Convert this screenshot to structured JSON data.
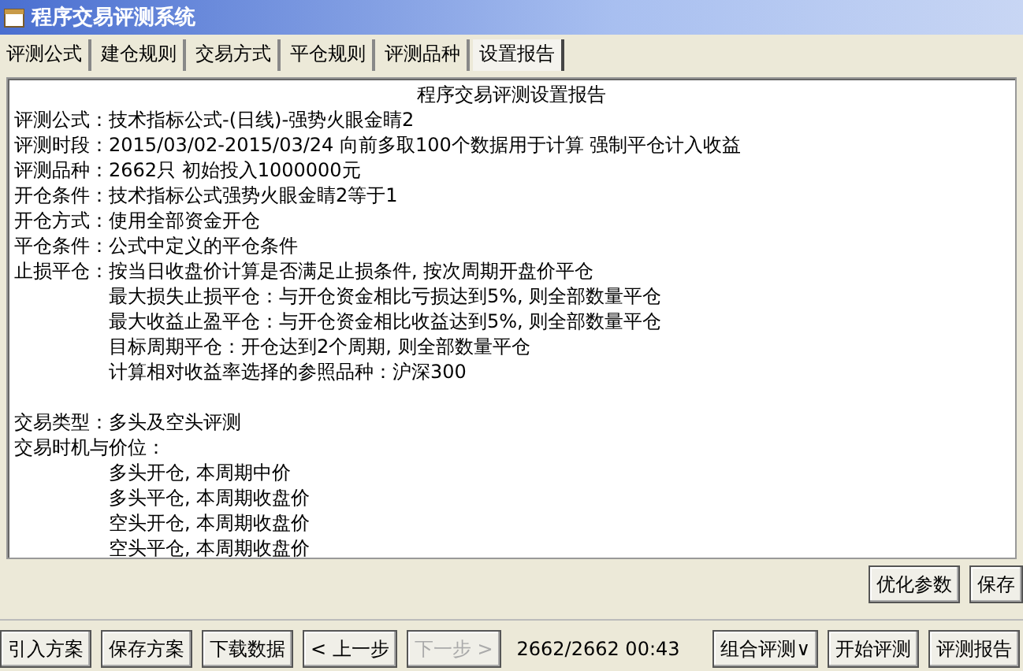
{
  "window": {
    "title": "程序交易评测系统"
  },
  "tabs": [
    {
      "label": "评测公式",
      "selected": false
    },
    {
      "label": "建仓规则",
      "selected": false
    },
    {
      "label": "交易方式",
      "selected": false
    },
    {
      "label": "平仓规则",
      "selected": false
    },
    {
      "label": "评测品种",
      "selected": false
    },
    {
      "label": "设置报告",
      "selected": true
    }
  ],
  "report": {
    "title": "程序交易评测设置报告",
    "lines": [
      {
        "kind": "field",
        "label": "评测公式：",
        "value": "技术指标公式-(日线)-强势火眼金睛2"
      },
      {
        "kind": "field",
        "label": "评测时段：",
        "value": "2015/03/02-2015/03/24  向前多取100个数据用于计算  强制平仓计入收益"
      },
      {
        "kind": "field",
        "label": "评测品种：",
        "value": "2662只  初始投入1000000元"
      },
      {
        "kind": "field",
        "label": "开仓条件：",
        "value": "技术指标公式强势火眼金睛2等于1"
      },
      {
        "kind": "field",
        "label": "开仓方式：",
        "value": "使用全部资金开仓"
      },
      {
        "kind": "field",
        "label": "平仓条件：",
        "value": "公式中定义的平仓条件"
      },
      {
        "kind": "field",
        "label": "止损平仓：",
        "value": "按当日收盘价计算是否满足止损条件, 按次周期开盘价平仓"
      },
      {
        "kind": "indent",
        "value": "最大损失止损平仓：与开仓资金相比亏损达到5%, 则全部数量平仓"
      },
      {
        "kind": "indent",
        "value": "最大收益止盈平仓：与开仓资金相比收益达到5%, 则全部数量平仓"
      },
      {
        "kind": "indent",
        "value": "目标周期平仓：开仓达到2个周期, 则全部数量平仓"
      },
      {
        "kind": "indent",
        "value": "计算相对收益率选择的参照品种：沪深300"
      },
      {
        "kind": "gap"
      },
      {
        "kind": "field",
        "label": "交易类型：",
        "value": "多头及空头评测"
      },
      {
        "kind": "field",
        "label": "交易时机与价位："
      },
      {
        "kind": "indent",
        "value": "多头开仓, 本周期中价"
      },
      {
        "kind": "indent",
        "value": "多头平仓, 本周期收盘价"
      },
      {
        "kind": "indent",
        "value": "空头开仓, 本周期收盘价"
      },
      {
        "kind": "indent",
        "value": "空头平仓, 本周期收盘价"
      }
    ]
  },
  "side_buttons": [
    {
      "label": "优化参数",
      "disabled": false
    },
    {
      "label": "保存",
      "disabled": false
    }
  ],
  "bottom_left_buttons": [
    {
      "label": "引入方案",
      "disabled": false
    },
    {
      "label": "保存方案",
      "disabled": false
    },
    {
      "label": "下载数据",
      "disabled": false
    },
    {
      "label": "< 上一步",
      "disabled": false
    },
    {
      "label": "下一步 >",
      "disabled": true
    }
  ],
  "progress": "2662/2662  00:43",
  "bottom_right_buttons": [
    {
      "label": "组合评测∨",
      "disabled": false
    },
    {
      "label": "开始评测",
      "disabled": false
    },
    {
      "label": "评测报告",
      "disabled": false
    }
  ]
}
